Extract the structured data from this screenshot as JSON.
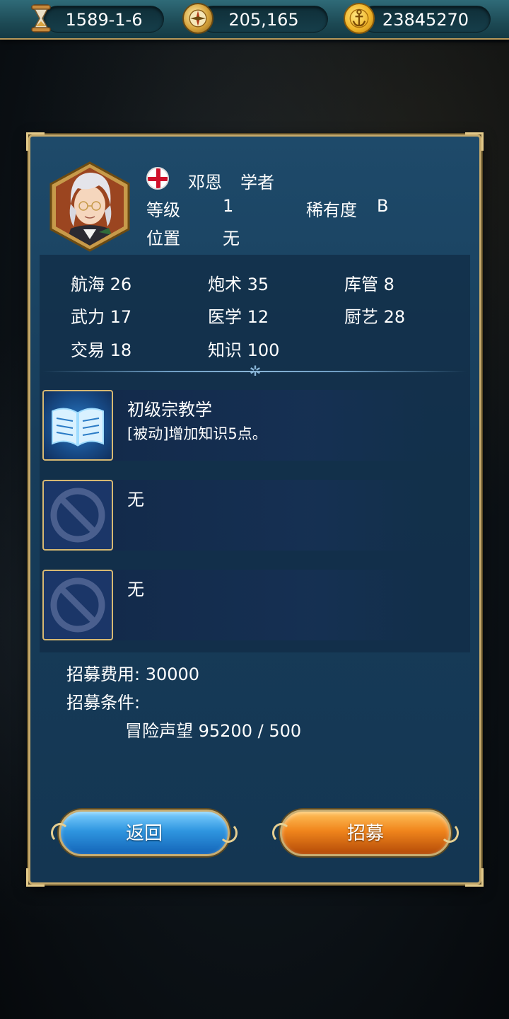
{
  "topbar": {
    "date": "1589-1-6",
    "compass_value": "205,165",
    "gold": "23845270",
    "icons": [
      "hourglass-icon",
      "compass-icon",
      "anchor-coin-icon"
    ]
  },
  "character": {
    "name": "邓恩",
    "title": "学者",
    "flag": "england-flag",
    "level_label": "等级",
    "level": "1",
    "rarity_label": "稀有度",
    "rarity": "B",
    "position_label": "位置",
    "position": "无"
  },
  "stats": [
    {
      "label": "航海",
      "value": "26"
    },
    {
      "label": "炮术",
      "value": "35"
    },
    {
      "label": "库管",
      "value": "8"
    },
    {
      "label": "武力",
      "value": "17"
    },
    {
      "label": "医学",
      "value": "12"
    },
    {
      "label": "厨艺",
      "value": "28"
    },
    {
      "label": "交易",
      "value": "18"
    },
    {
      "label": "知识",
      "value": "100"
    }
  ],
  "skills": [
    {
      "name": "初级宗教学",
      "desc": "[被动]增加知识5点。",
      "icon": "book-icon"
    },
    {
      "name": "无",
      "desc": "",
      "icon": "prohibited-icon"
    },
    {
      "name": "无",
      "desc": "",
      "icon": "prohibited-icon"
    }
  ],
  "recruit": {
    "cost_label": "招募费用: 30000",
    "condition_label": "招募条件:",
    "condition": "冒险声望 95200 / 500"
  },
  "buttons": {
    "back": "返回",
    "recruit": "招募"
  },
  "colors": {
    "panel": "#173d5b",
    "border_gold": "#c5a96b",
    "back_button": "#2f96e0",
    "recruit_button": "#f0851c"
  }
}
